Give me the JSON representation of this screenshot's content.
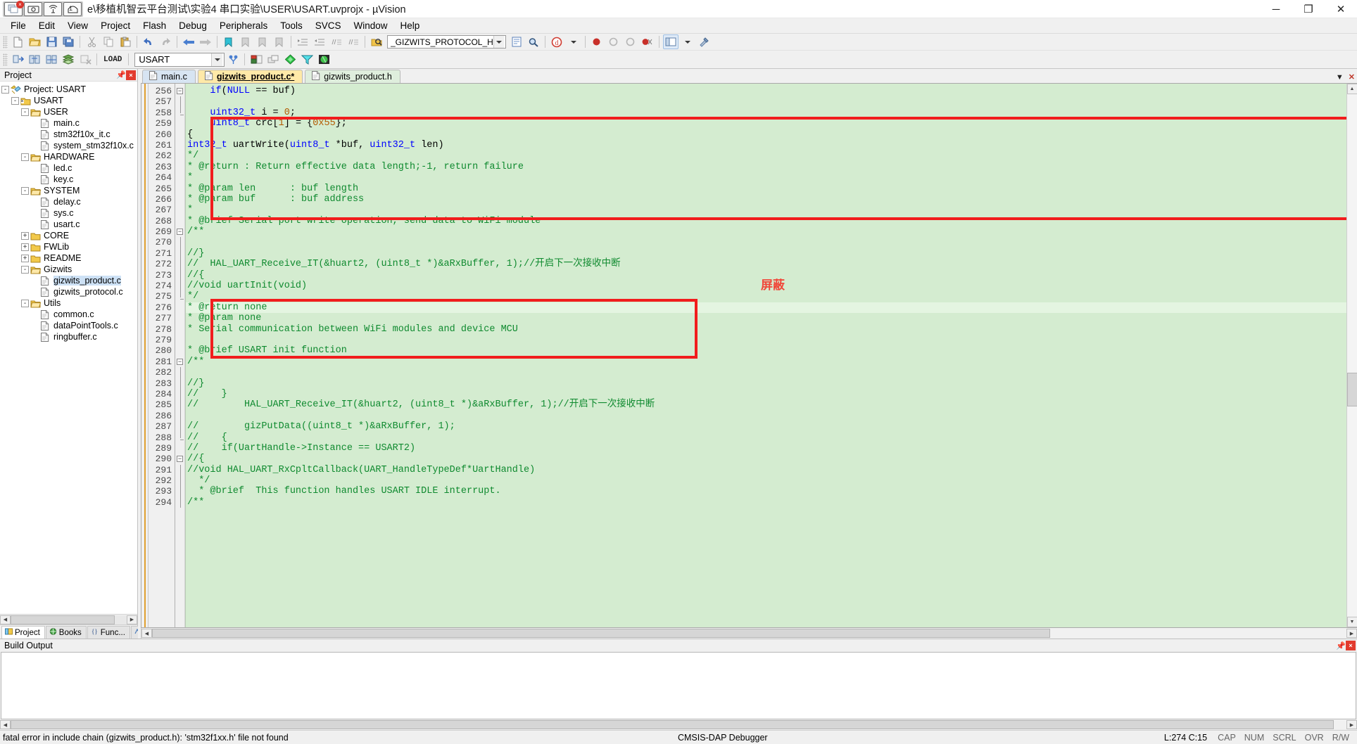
{
  "window": {
    "title": "e\\移植机智云平台测试\\实验4 串口实验\\USER\\USART.uvprojx - µVision",
    "badge": "1",
    "minimize": "─",
    "maximize": "❐",
    "close": "✕"
  },
  "menu": {
    "items": [
      "File",
      "Edit",
      "View",
      "Project",
      "Flash",
      "Debug",
      "Peripherals",
      "Tools",
      "SVCS",
      "Window",
      "Help"
    ]
  },
  "toolbar1": {
    "define_combo_value": "_GIZWITS_PROTOCOL_H",
    "icons": [
      "new-file-icon",
      "open-file-icon",
      "save-icon",
      "save-all-icon",
      "cut-icon",
      "copy-icon",
      "paste-icon",
      "undo-icon",
      "redo-icon",
      "navigate-back-icon",
      "navigate-forward-icon",
      "bookmark-toggle-icon",
      "bookmark-prev-icon",
      "bookmark-next-icon",
      "bookmark-clear-icon",
      "indent-icon",
      "outdent-icon",
      "comment-icon",
      "uncomment-icon",
      "find-in-files-icon",
      "browse-icon",
      "find-icon",
      "debug-icon",
      "breakpoint-icon",
      "disable-breakpoint-icon",
      "kill-breakpoints-icon",
      "disable-all-breakpoints-icon",
      "window-layout-icon",
      "configure-icon"
    ]
  },
  "toolbar2": {
    "target_combo_value": "USART",
    "load_label": "LOAD",
    "icons": [
      "translate-icon",
      "build-icon",
      "rebuild-icon",
      "batch-build-icon",
      "stop-build-icon",
      "download-icon",
      "target-options-icon",
      "manage-project-items-icon",
      "multi-project-icon",
      "pack-installer-icon",
      "run-to-cursor-icon"
    ]
  },
  "project_pane": {
    "header": "Project",
    "pin_icon": "pin-icon",
    "close_icon": "close-icon",
    "tree": [
      {
        "label": "Project: USART",
        "indent": 0,
        "expander": "-",
        "icon": "project-icon"
      },
      {
        "label": "USART",
        "indent": 1,
        "expander": "-",
        "icon": "target-icon"
      },
      {
        "label": "USER",
        "indent": 2,
        "expander": "-",
        "icon": "folder-open-icon"
      },
      {
        "label": "main.c",
        "indent": 3,
        "expander": "",
        "icon": "c-file-icon"
      },
      {
        "label": "stm32f10x_it.c",
        "indent": 3,
        "expander": "",
        "icon": "c-file-icon"
      },
      {
        "label": "system_stm32f10x.c",
        "indent": 3,
        "expander": "",
        "icon": "c-file-icon"
      },
      {
        "label": "HARDWARE",
        "indent": 2,
        "expander": "-",
        "icon": "folder-open-icon"
      },
      {
        "label": "led.c",
        "indent": 3,
        "expander": "",
        "icon": "c-file-icon"
      },
      {
        "label": "key.c",
        "indent": 3,
        "expander": "",
        "icon": "c-file-icon"
      },
      {
        "label": "SYSTEM",
        "indent": 2,
        "expander": "-",
        "icon": "folder-open-icon"
      },
      {
        "label": "delay.c",
        "indent": 3,
        "expander": "",
        "icon": "c-file-icon"
      },
      {
        "label": "sys.c",
        "indent": 3,
        "expander": "",
        "icon": "c-file-icon"
      },
      {
        "label": "usart.c",
        "indent": 3,
        "expander": "",
        "icon": "c-file-icon"
      },
      {
        "label": "CORE",
        "indent": 2,
        "expander": "+",
        "icon": "folder-closed-icon"
      },
      {
        "label": "FWLib",
        "indent": 2,
        "expander": "+",
        "icon": "folder-closed-icon"
      },
      {
        "label": "README",
        "indent": 2,
        "expander": "+",
        "icon": "folder-closed-icon"
      },
      {
        "label": "Gizwits",
        "indent": 2,
        "expander": "-",
        "icon": "folder-open-icon"
      },
      {
        "label": "gizwits_product.c",
        "indent": 3,
        "expander": "",
        "icon": "c-file-icon",
        "selected": true
      },
      {
        "label": "gizwits_protocol.c",
        "indent": 3,
        "expander": "",
        "icon": "c-file-icon"
      },
      {
        "label": "Utils",
        "indent": 2,
        "expander": "-",
        "icon": "folder-open-icon"
      },
      {
        "label": "common.c",
        "indent": 3,
        "expander": "",
        "icon": "c-file-icon"
      },
      {
        "label": "dataPointTools.c",
        "indent": 3,
        "expander": "",
        "icon": "c-file-icon"
      },
      {
        "label": "ringbuffer.c",
        "indent": 3,
        "expander": "",
        "icon": "c-file-icon"
      }
    ],
    "bottom_tabs": [
      {
        "label": "Project",
        "icon": "project-tab-icon",
        "active": true
      },
      {
        "label": "Books",
        "icon": "books-tab-icon",
        "active": false
      },
      {
        "label": "Func...",
        "icon": "functions-tab-icon",
        "active": false
      },
      {
        "label": "Temp...",
        "icon": "templates-tab-icon",
        "active": false
      }
    ]
  },
  "editor": {
    "tabs": [
      {
        "label": "main.c",
        "state": "normal"
      },
      {
        "label": "gizwits_product.c*",
        "state": "active"
      },
      {
        "label": "gizwits_product.h",
        "state": "plain"
      }
    ],
    "tab_nav": {
      "prev": "▼",
      "close": "✕"
    },
    "first_line_number": 256,
    "lines": [
      {
        "n": 256,
        "text": "/**",
        "cls": "cm",
        "fold": "minus"
      },
      {
        "n": 257,
        "text": "  * @brief  This function handles USART IDLE interrupt.",
        "cls": "cm",
        "fold": "bar"
      },
      {
        "n": 258,
        "text": "  */",
        "cls": "cm",
        "fold": "end"
      },
      {
        "n": 259,
        "text": "//void HAL_UART_RxCpltCallback(UART_HandleTypeDef*UartHandle)",
        "cls": "cm"
      },
      {
        "n": 260,
        "text": "//{",
        "cls": "cm"
      },
      {
        "n": 261,
        "text": "//    if(UartHandle->Instance == USART2)",
        "cls": "cm"
      },
      {
        "n": 262,
        "text": "//    {",
        "cls": "cm"
      },
      {
        "n": 263,
        "text": "//        gizPutData((uint8_t *)&aRxBuffer, 1);",
        "cls": "cm"
      },
      {
        "n": 264,
        "text": "",
        "cls": "cm"
      },
      {
        "n": 265,
        "text": "//        HAL_UART_Receive_IT(&huart2, (uint8_t *)&aRxBuffer, 1);//开启下一次接收中断",
        "cls": "cm"
      },
      {
        "n": 266,
        "text": "//    }",
        "cls": "cm"
      },
      {
        "n": 267,
        "text": "//}",
        "cls": "cm"
      },
      {
        "n": 268,
        "text": "",
        "cls": "cm"
      },
      {
        "n": 269,
        "text": "/**",
        "cls": "cm",
        "fold": "minus"
      },
      {
        "n": 270,
        "text": "* @brief USART init function",
        "cls": "cm",
        "fold": "bar"
      },
      {
        "n": 271,
        "text": "",
        "cls": "cm",
        "fold": "bar"
      },
      {
        "n": 272,
        "text": "* Serial communication between WiFi modules and device MCU",
        "cls": "cm",
        "fold": "bar"
      },
      {
        "n": 273,
        "text": "* @param none",
        "cls": "cm",
        "fold": "bar"
      },
      {
        "n": 274,
        "text": "* @return none",
        "cls": "cm",
        "fold": "bar",
        "highlight": true
      },
      {
        "n": 275,
        "text": "*/",
        "cls": "cm",
        "fold": "end"
      },
      {
        "n": 276,
        "text": "//void uartInit(void)",
        "cls": "cm"
      },
      {
        "n": 277,
        "text": "//{",
        "cls": "cm"
      },
      {
        "n": 278,
        "text": "//  HAL_UART_Receive_IT(&huart2, (uint8_t *)&aRxBuffer, 1);//开启下一次接收中断",
        "cls": "cm"
      },
      {
        "n": 279,
        "text": "//}",
        "cls": "cm"
      },
      {
        "n": 280,
        "text": "",
        "cls": "cm"
      },
      {
        "n": 281,
        "text": "/**",
        "cls": "cm",
        "fold": "minus"
      },
      {
        "n": 282,
        "text": "* @brief Serial port write operation, send data to WiFi module",
        "cls": "cm",
        "fold": "bar"
      },
      {
        "n": 283,
        "text": "*",
        "cls": "cm",
        "fold": "bar"
      },
      {
        "n": 284,
        "text": "* @param buf      : buf address",
        "cls": "cm",
        "fold": "bar"
      },
      {
        "n": 285,
        "text": "* @param len      : buf length",
        "cls": "cm",
        "fold": "bar"
      },
      {
        "n": 286,
        "text": "*",
        "cls": "cm",
        "fold": "bar"
      },
      {
        "n": 287,
        "text": "* @return : Return effective data length;-1, return failure",
        "cls": "cm",
        "fold": "bar"
      },
      {
        "n": 288,
        "text": "*/",
        "cls": "cm",
        "fold": "end"
      },
      {
        "n": 289,
        "text": "int32_t uartWrite(uint8_t *buf, uint32_t len)",
        "cls": "pl"
      },
      {
        "n": 290,
        "text": "{",
        "cls": "pl",
        "fold": "minus"
      },
      {
        "n": 291,
        "text": "    uint8_t crc[1] = {0x55};",
        "cls": "pl",
        "fold": "bar"
      },
      {
        "n": 292,
        "text": "    uint32_t i = 0;",
        "cls": "pl",
        "fold": "bar"
      },
      {
        "n": 293,
        "text": "",
        "cls": "pl",
        "fold": "bar"
      },
      {
        "n": 294,
        "text": "    if(NULL == buf)",
        "cls": "pl",
        "fold": "bar"
      }
    ],
    "annotation": "屏蔽",
    "annotation_color": "#f0483a"
  },
  "build_output": {
    "header": "Build Output",
    "text": "",
    "pin_icon": "pin-icon",
    "close_icon": "close-icon"
  },
  "status_bar": {
    "message": "fatal error in include chain (gizwits_product.h): 'stm32f1xx.h' file not found",
    "debugger": "CMSIS-DAP Debugger",
    "position": "L:274 C:15",
    "flags": [
      "CAP",
      "NUM",
      "SCRL",
      "OVR",
      "R/W"
    ]
  }
}
